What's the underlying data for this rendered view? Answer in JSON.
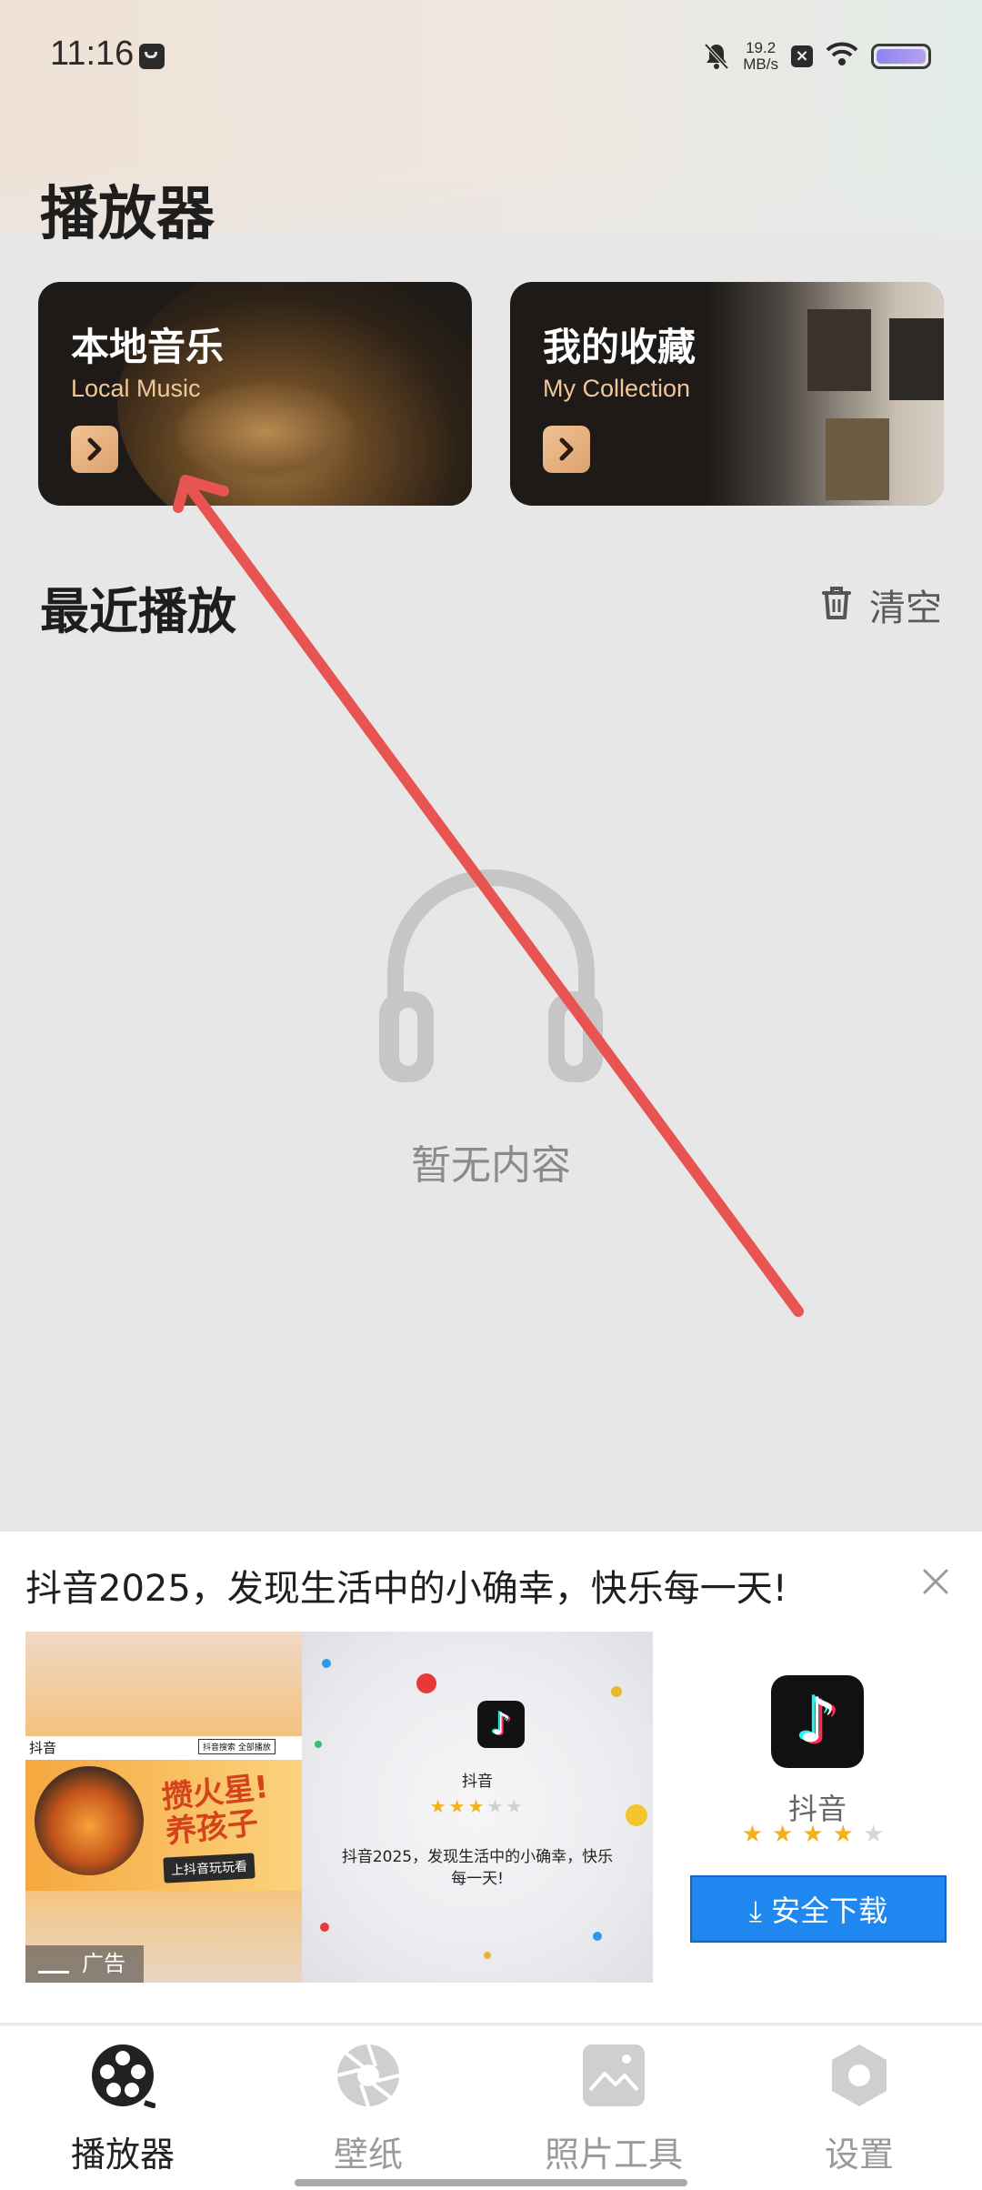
{
  "status_bar": {
    "time": "11:16",
    "net_speed_value": "19.2",
    "net_speed_unit": "MB/s"
  },
  "page": {
    "title": "播放器"
  },
  "cards": [
    {
      "title": "本地音乐",
      "subtitle": "Local Music"
    },
    {
      "title": "我的收藏",
      "subtitle": "My Collection"
    }
  ],
  "recent": {
    "title": "最近播放",
    "clear_label": "清空",
    "empty_text": "暂无内容"
  },
  "ad": {
    "headline": "抖音2025，发现生活中的小确幸，快乐每一天!",
    "tag": "广告",
    "creative_app_name": "抖音",
    "creative_logo_text": "抖音",
    "creative_tabs": "抖音搜索 全部播放",
    "creative_slogan_1": "攒火星!",
    "creative_slogan_2": "养孩子",
    "creative_cta": "上抖音玩玩看",
    "creative_rating": 3,
    "creative_desc": "抖音2025，发现生活中的小确幸，快乐每一天!",
    "app_name": "抖音",
    "app_rating": 4,
    "download_label": "安全下载"
  },
  "tabs": [
    {
      "label": "播放器",
      "icon": "film-reel-icon",
      "active": true
    },
    {
      "label": "壁纸",
      "icon": "aperture-icon",
      "active": false
    },
    {
      "label": "照片工具",
      "icon": "image-icon",
      "active": false
    },
    {
      "label": "设置",
      "icon": "hexagon-settings-icon",
      "active": false
    }
  ],
  "colors": {
    "accent": "#1f87f0",
    "card_subtitle": "#f0c798",
    "star": "#f3b21b",
    "arrow": "#e85452"
  }
}
